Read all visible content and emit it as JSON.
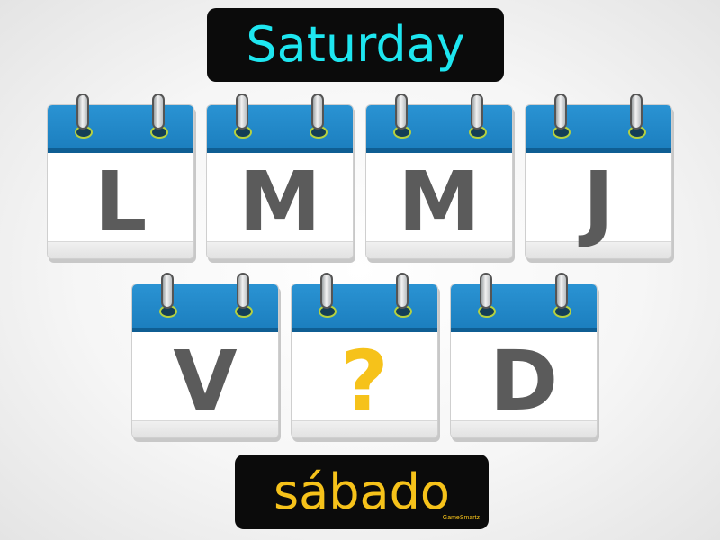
{
  "title": "Saturday",
  "answer": "sábado",
  "watermark": "GameSmartz",
  "colors": {
    "title_text": "#1ee6f0",
    "answer_text": "#f6c21a",
    "letter": "#5b5b5b",
    "question_mark": "#f6c21a",
    "calendar_header": "#1c7fbf",
    "label_background": "#0b0b0b"
  },
  "calendars": [
    {
      "letter": "L",
      "highlight": false
    },
    {
      "letter": "M",
      "highlight": false
    },
    {
      "letter": "M",
      "highlight": false
    },
    {
      "letter": "J",
      "highlight": false
    },
    {
      "letter": "V",
      "highlight": false
    },
    {
      "letter": "?",
      "highlight": true
    },
    {
      "letter": "D",
      "highlight": false
    }
  ]
}
